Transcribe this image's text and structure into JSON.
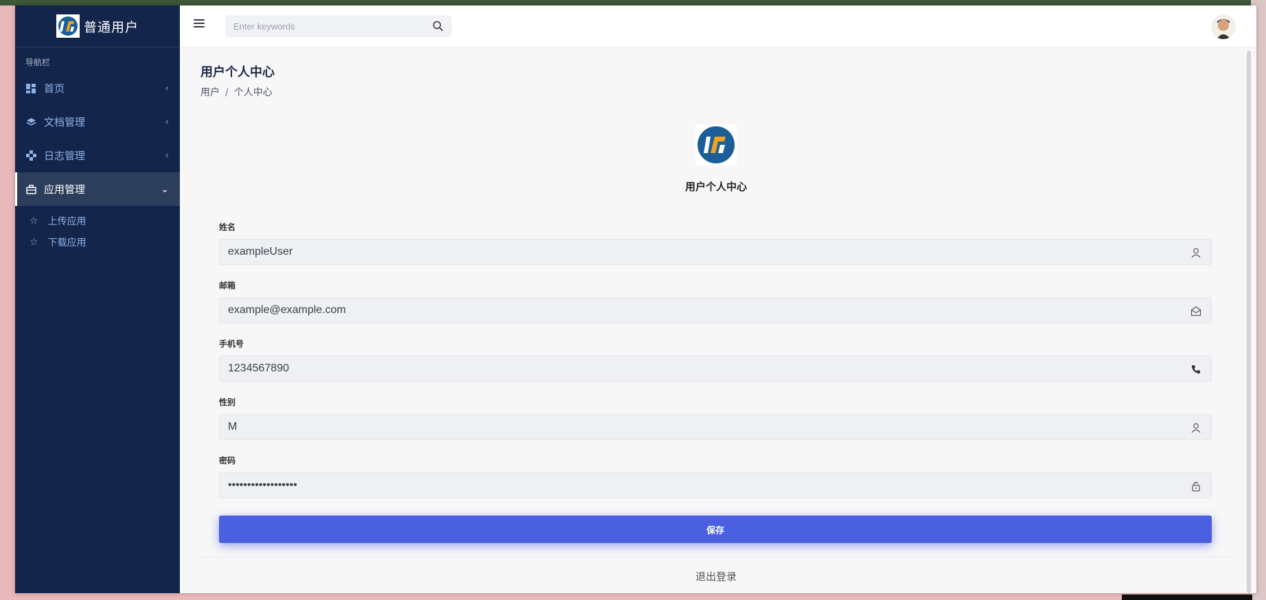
{
  "sidebar": {
    "brand_title": "普通用户",
    "nav_caption": "导航栏",
    "items": [
      {
        "label": "首页",
        "icon": "dashboard-icon"
      },
      {
        "label": "文档管理",
        "icon": "layers-icon"
      },
      {
        "label": "日志管理",
        "icon": "nodes-icon"
      },
      {
        "label": "应用管理",
        "icon": "briefcase-icon",
        "active": true
      }
    ],
    "subitems": [
      {
        "label": "上传应用",
        "icon": "star-icon"
      },
      {
        "label": "下载应用",
        "icon": "star-icon"
      }
    ]
  },
  "header": {
    "search_placeholder": "Enter keywords"
  },
  "page": {
    "title": "用户个人中心",
    "breadcrumb": [
      "用户",
      "个人中心"
    ],
    "breadcrumb_sep": "/",
    "profile_heading": "用户个人中心"
  },
  "form": {
    "fields": [
      {
        "label": "姓名",
        "value": "exampleUser",
        "icon": "user-icon"
      },
      {
        "label": "邮箱",
        "value": "example@example.com",
        "icon": "envelope-open-icon"
      },
      {
        "label": "手机号",
        "value": "1234567890",
        "icon": "phone-icon"
      },
      {
        "label": "性别",
        "value": "M",
        "icon": "user-icon"
      },
      {
        "label": "密码",
        "value": "••••••••••••••••••",
        "icon": "lock-icon"
      }
    ],
    "save_label": "保存",
    "logout_label": "退出登录"
  },
  "colors": {
    "sidebar_bg": "#13254a",
    "primary": "#4a60e0",
    "sidebar_text": "#8fb2e6"
  }
}
